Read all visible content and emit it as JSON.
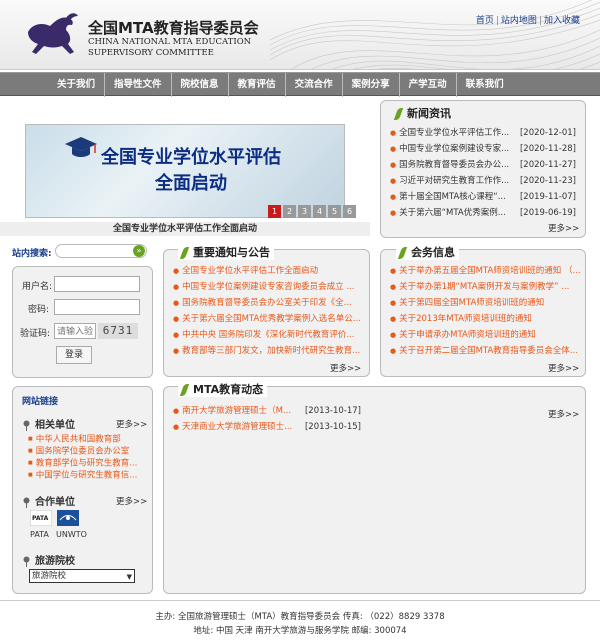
{
  "header": {
    "title_cn": "全国MTA教育指导委员会",
    "title_en_1": "CHINA NATIONAL MTA EDUCATION",
    "title_en_2": "SUPERVISORY COMMITTEE",
    "top_links": [
      "首页",
      "站内地图",
      "加入收藏"
    ]
  },
  "nav": [
    "关于我们",
    "指导性文件",
    "院校信息",
    "教育评估",
    "交流合作",
    "案例分享",
    "产学互动",
    "联系我们"
  ],
  "banner": {
    "text_line1": "全国专业学位水平评估",
    "text_line2": "全面启动",
    "pages": [
      "1",
      "2",
      "3",
      "4",
      "5",
      "6"
    ],
    "active_page": "1",
    "caption": "全国专业学位水平评估工作全面启动"
  },
  "news": {
    "title": "新闻资讯",
    "items": [
      {
        "text": "全国专业学位水平评估工作...",
        "date": "[2020-12-01]"
      },
      {
        "text": "中国专业学位案例建设专家...",
        "date": "[2020-11-28]"
      },
      {
        "text": "国务院教育督导委员会办公...",
        "date": "[2020-11-27]"
      },
      {
        "text": "习近平对研究生教育工作作...",
        "date": "[2020-11-23]"
      },
      {
        "text": "第十届全国MTA核心课程“...",
        "date": "[2019-11-07]"
      },
      {
        "text": "关于第六届“MTA优秀案例...",
        "date": "[2019-06-19]"
      }
    ],
    "more": "更多>>"
  },
  "search": {
    "label": "站内搜索:",
    "button": "»"
  },
  "login": {
    "username_label": "用户名:",
    "password_label": "密码:",
    "captcha_label": "验证码:",
    "captcha_placeholder": "请输入验",
    "captcha_code": "6731",
    "submit": "登录"
  },
  "notices": {
    "title": "重要通知与公告",
    "items": [
      "全国专业学位水平评估工作全面启动",
      "中国专业学位案例建设专家咨询委员会成立 ...",
      "国务院教育督导委员会办公室关于印发《全...",
      "关于第六届全国MTA优秀教学案例入选名单公...",
      "中共中央 国务院印发《深化新时代教育评价...",
      "教育部等三部门发文，加快新时代研究生教育..."
    ],
    "more": "更多>>"
  },
  "affairs": {
    "title": "会务信息",
    "items": [
      "关于举办第五届全国MTA师资培训班的通知 （...",
      "关于举办第1期“MTA案例开发与案例教学” ...",
      "关于第四届全国MTA师资培训班的通知",
      "关于2013年MTA师资培训班的通知",
      "关于申请承办MTA师资培训班的通知",
      "关于召开第二届全国MTA教育指导委员会全体..."
    ],
    "more": "更多>>"
  },
  "sidebar_links": {
    "title": "网站链接",
    "related": {
      "title": "相关单位",
      "more": "更多>>",
      "items": [
        "中华人民共和国教育部",
        "国务院学位委员会办公室",
        "教育部学位与研究生教育...",
        "中国学位与研究生教育信..."
      ]
    },
    "partners": {
      "title": "合作单位",
      "more": "更多>>",
      "items": [
        "PATA",
        "UNWTO"
      ]
    },
    "schools": {
      "title": "旅游院校",
      "selected": "旅游院校"
    }
  },
  "dynamics": {
    "title": "MTA教育动态",
    "items": [
      {
        "text": "南开大学旅游管理硕士（M...",
        "date": "[2013-10-17]"
      },
      {
        "text": "天津商业大学旅游管理硕士...",
        "date": "[2013-10-15]"
      }
    ],
    "more": "更多>>"
  },
  "footer": {
    "line1": "主办: 全国旅游管理硕士（MTA）教育指导委员会 传真: （022）8829 3378",
    "line2": "地址: 中国 天津 南开大学旅游与服务学院   邮编: 300074"
  },
  "colors": {
    "nav_bg": "#7b7b7b",
    "accent_orange": "#e8581a",
    "leaf_green": "#6aa321",
    "link_blue": "#1a3e8c",
    "banner_text": "#0b2d83"
  }
}
